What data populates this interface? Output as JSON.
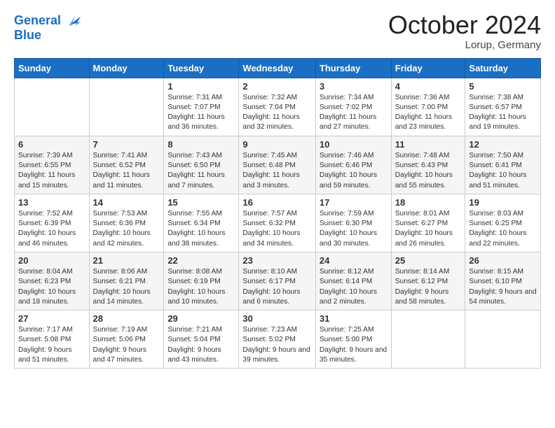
{
  "header": {
    "logo_line1": "General",
    "logo_line2": "Blue",
    "month_title": "October 2024",
    "location": "Lorup, Germany"
  },
  "weekdays": [
    "Sunday",
    "Monday",
    "Tuesday",
    "Wednesday",
    "Thursday",
    "Friday",
    "Saturday"
  ],
  "weeks": [
    [
      {
        "day": "",
        "sunrise": "",
        "sunset": "",
        "daylight": ""
      },
      {
        "day": "",
        "sunrise": "",
        "sunset": "",
        "daylight": ""
      },
      {
        "day": "1",
        "sunrise": "Sunrise: 7:31 AM",
        "sunset": "Sunset: 7:07 PM",
        "daylight": "Daylight: 11 hours and 36 minutes."
      },
      {
        "day": "2",
        "sunrise": "Sunrise: 7:32 AM",
        "sunset": "Sunset: 7:04 PM",
        "daylight": "Daylight: 11 hours and 32 minutes."
      },
      {
        "day": "3",
        "sunrise": "Sunrise: 7:34 AM",
        "sunset": "Sunset: 7:02 PM",
        "daylight": "Daylight: 11 hours and 27 minutes."
      },
      {
        "day": "4",
        "sunrise": "Sunrise: 7:36 AM",
        "sunset": "Sunset: 7:00 PM",
        "daylight": "Daylight: 11 hours and 23 minutes."
      },
      {
        "day": "5",
        "sunrise": "Sunrise: 7:38 AM",
        "sunset": "Sunset: 6:57 PM",
        "daylight": "Daylight: 11 hours and 19 minutes."
      }
    ],
    [
      {
        "day": "6",
        "sunrise": "Sunrise: 7:39 AM",
        "sunset": "Sunset: 6:55 PM",
        "daylight": "Daylight: 11 hours and 15 minutes."
      },
      {
        "day": "7",
        "sunrise": "Sunrise: 7:41 AM",
        "sunset": "Sunset: 6:52 PM",
        "daylight": "Daylight: 11 hours and 11 minutes."
      },
      {
        "day": "8",
        "sunrise": "Sunrise: 7:43 AM",
        "sunset": "Sunset: 6:50 PM",
        "daylight": "Daylight: 11 hours and 7 minutes."
      },
      {
        "day": "9",
        "sunrise": "Sunrise: 7:45 AM",
        "sunset": "Sunset: 6:48 PM",
        "daylight": "Daylight: 11 hours and 3 minutes."
      },
      {
        "day": "10",
        "sunrise": "Sunrise: 7:46 AM",
        "sunset": "Sunset: 6:46 PM",
        "daylight": "Daylight: 10 hours and 59 minutes."
      },
      {
        "day": "11",
        "sunrise": "Sunrise: 7:48 AM",
        "sunset": "Sunset: 6:43 PM",
        "daylight": "Daylight: 10 hours and 55 minutes."
      },
      {
        "day": "12",
        "sunrise": "Sunrise: 7:50 AM",
        "sunset": "Sunset: 6:41 PM",
        "daylight": "Daylight: 10 hours and 51 minutes."
      }
    ],
    [
      {
        "day": "13",
        "sunrise": "Sunrise: 7:52 AM",
        "sunset": "Sunset: 6:39 PM",
        "daylight": "Daylight: 10 hours and 46 minutes."
      },
      {
        "day": "14",
        "sunrise": "Sunrise: 7:53 AM",
        "sunset": "Sunset: 6:36 PM",
        "daylight": "Daylight: 10 hours and 42 minutes."
      },
      {
        "day": "15",
        "sunrise": "Sunrise: 7:55 AM",
        "sunset": "Sunset: 6:34 PM",
        "daylight": "Daylight: 10 hours and 38 minutes."
      },
      {
        "day": "16",
        "sunrise": "Sunrise: 7:57 AM",
        "sunset": "Sunset: 6:32 PM",
        "daylight": "Daylight: 10 hours and 34 minutes."
      },
      {
        "day": "17",
        "sunrise": "Sunrise: 7:59 AM",
        "sunset": "Sunset: 6:30 PM",
        "daylight": "Daylight: 10 hours and 30 minutes."
      },
      {
        "day": "18",
        "sunrise": "Sunrise: 8:01 AM",
        "sunset": "Sunset: 6:27 PM",
        "daylight": "Daylight: 10 hours and 26 minutes."
      },
      {
        "day": "19",
        "sunrise": "Sunrise: 8:03 AM",
        "sunset": "Sunset: 6:25 PM",
        "daylight": "Daylight: 10 hours and 22 minutes."
      }
    ],
    [
      {
        "day": "20",
        "sunrise": "Sunrise: 8:04 AM",
        "sunset": "Sunset: 6:23 PM",
        "daylight": "Daylight: 10 hours and 18 minutes."
      },
      {
        "day": "21",
        "sunrise": "Sunrise: 8:06 AM",
        "sunset": "Sunset: 6:21 PM",
        "daylight": "Daylight: 10 hours and 14 minutes."
      },
      {
        "day": "22",
        "sunrise": "Sunrise: 8:08 AM",
        "sunset": "Sunset: 6:19 PM",
        "daylight": "Daylight: 10 hours and 10 minutes."
      },
      {
        "day": "23",
        "sunrise": "Sunrise: 8:10 AM",
        "sunset": "Sunset: 6:17 PM",
        "daylight": "Daylight: 10 hours and 6 minutes."
      },
      {
        "day": "24",
        "sunrise": "Sunrise: 8:12 AM",
        "sunset": "Sunset: 6:14 PM",
        "daylight": "Daylight: 10 hours and 2 minutes."
      },
      {
        "day": "25",
        "sunrise": "Sunrise: 8:14 AM",
        "sunset": "Sunset: 6:12 PM",
        "daylight": "Daylight: 9 hours and 58 minutes."
      },
      {
        "day": "26",
        "sunrise": "Sunrise: 8:15 AM",
        "sunset": "Sunset: 6:10 PM",
        "daylight": "Daylight: 9 hours and 54 minutes."
      }
    ],
    [
      {
        "day": "27",
        "sunrise": "Sunrise: 7:17 AM",
        "sunset": "Sunset: 5:08 PM",
        "daylight": "Daylight: 9 hours and 51 minutes."
      },
      {
        "day": "28",
        "sunrise": "Sunrise: 7:19 AM",
        "sunset": "Sunset: 5:06 PM",
        "daylight": "Daylight: 9 hours and 47 minutes."
      },
      {
        "day": "29",
        "sunrise": "Sunrise: 7:21 AM",
        "sunset": "Sunset: 5:04 PM",
        "daylight": "Daylight: 9 hours and 43 minutes."
      },
      {
        "day": "30",
        "sunrise": "Sunrise: 7:23 AM",
        "sunset": "Sunset: 5:02 PM",
        "daylight": "Daylight: 9 hours and 39 minutes."
      },
      {
        "day": "31",
        "sunrise": "Sunrise: 7:25 AM",
        "sunset": "Sunset: 5:00 PM",
        "daylight": "Daylight: 9 hours and 35 minutes."
      },
      {
        "day": "",
        "sunrise": "",
        "sunset": "",
        "daylight": ""
      },
      {
        "day": "",
        "sunrise": "",
        "sunset": "",
        "daylight": ""
      }
    ]
  ]
}
